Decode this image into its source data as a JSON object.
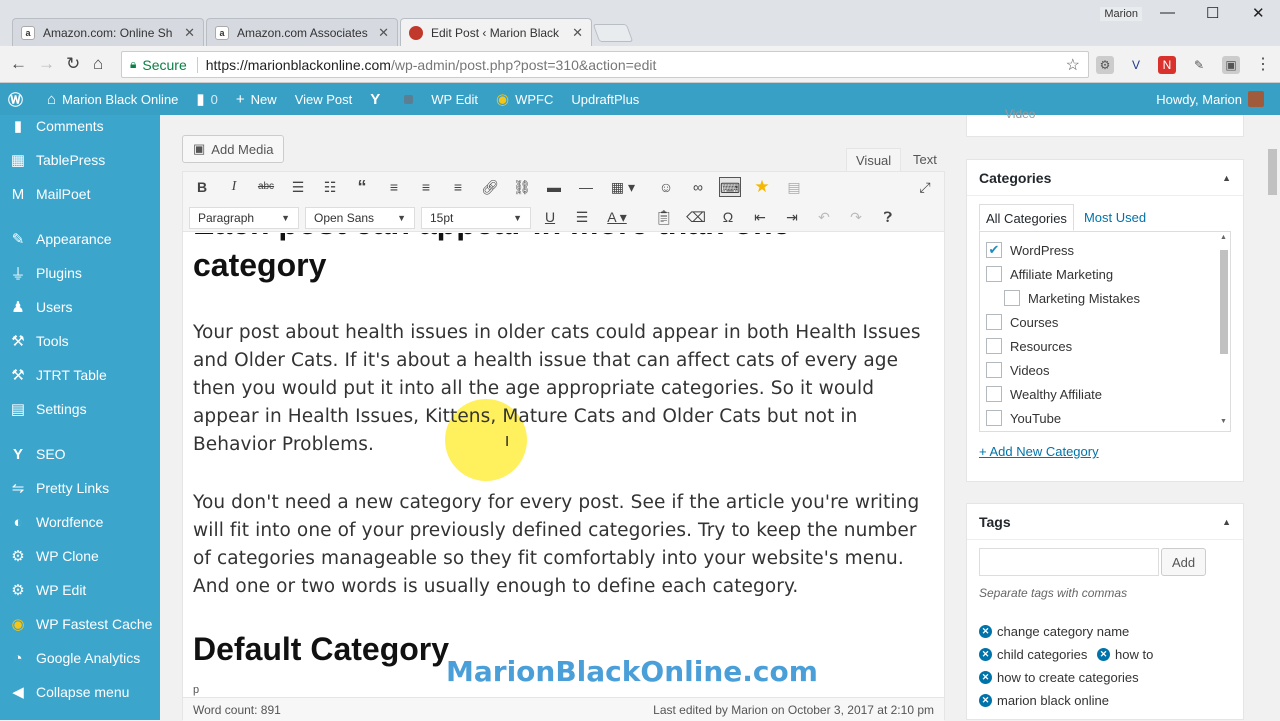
{
  "browser": {
    "tabs": [
      {
        "title": "Amazon.com: Online Sh",
        "icon": "amazon-icon"
      },
      {
        "title": "Amazon.com Associates",
        "icon": "amazon-icon"
      },
      {
        "title": "Edit Post ‹ Marion Black",
        "icon": "site-favicon"
      }
    ],
    "user": "Marion",
    "secure_label": "Secure",
    "url_host": "https://marionblackonline.com",
    "url_path": "/wp-admin/post.php?post=310&action=edit"
  },
  "adminbar": {
    "site_name": "Marion Black Online",
    "comments_count": "0",
    "new_label": "New",
    "view_post": "View Post",
    "wp_edit": "WP Edit",
    "wpfc": "WPFC",
    "updraft": "UpdraftPlus",
    "howdy": "Howdy, Marion"
  },
  "sidebar": {
    "items": [
      {
        "label": "Comments",
        "icon": "comments-icon"
      },
      {
        "label": "TablePress",
        "icon": "table-icon"
      },
      {
        "label": "MailPoet",
        "icon": "mailpoet-icon"
      },
      {
        "label": "Appearance",
        "icon": "brush-icon"
      },
      {
        "label": "Plugins",
        "icon": "plugin-icon"
      },
      {
        "label": "Users",
        "icon": "users-icon"
      },
      {
        "label": "Tools",
        "icon": "wrench-icon"
      },
      {
        "label": "JTRT Table",
        "icon": "jtrt-icon"
      },
      {
        "label": "Settings",
        "icon": "settings-icon"
      },
      {
        "label": "SEO",
        "icon": "yoast-icon"
      },
      {
        "label": "Pretty Links",
        "icon": "link-icon"
      },
      {
        "label": "Wordfence",
        "icon": "wordfence-icon"
      },
      {
        "label": "WP Clone",
        "icon": "gear-icon"
      },
      {
        "label": "WP Edit",
        "icon": "gear-icon"
      },
      {
        "label": "WP Fastest Cache",
        "icon": "cheetah-icon"
      },
      {
        "label": "Google Analytics",
        "icon": "analytics-icon"
      },
      {
        "label": "Collapse menu",
        "icon": "collapse-icon"
      }
    ]
  },
  "editor": {
    "add_media": "Add Media",
    "visual_tab": "Visual",
    "text_tab": "Text",
    "format_select": "Paragraph",
    "font_select": "Open Sans",
    "size_select": "15pt",
    "heading_partial": "Each post can appear in more than one",
    "heading_cont": "category",
    "para1": "Your post about health issues in older cats could appear in both Health Issues and Older Cats. If it's about a health issue that can affect cats of every age then you would put it into all the age appropriate categories. So it would appear in Health Issues, Kittens, Mature Cats and Older Cats but not in Behavior Problems.",
    "para2": "You don't need a new category for every post. See if the article you're writing will fit into one of your previously defined categories. Try to keep the number of categories manageable so they fit comfortably into your website's menu. And one or two words is usually enough to define each category.",
    "heading2": "Default Category",
    "path": "p",
    "word_count": "Word count: 891",
    "last_edited": "Last edited by Marion on October 3, 2017 at 2:10 pm",
    "watermark": "MarionBlackOnline.com"
  },
  "categories": {
    "title": "Categories",
    "tab_all": "All Categories",
    "tab_used": "Most Used",
    "items": [
      {
        "label": "WordPress",
        "checked": true,
        "child": false
      },
      {
        "label": "Affiliate Marketing",
        "checked": false,
        "child": false
      },
      {
        "label": "Marketing Mistakes",
        "checked": false,
        "child": true
      },
      {
        "label": "Courses",
        "checked": false,
        "child": false
      },
      {
        "label": "Resources",
        "checked": false,
        "child": false
      },
      {
        "label": "Videos",
        "checked": false,
        "child": false
      },
      {
        "label": "Wealthy Affiliate",
        "checked": false,
        "child": false
      },
      {
        "label": "YouTube",
        "checked": false,
        "child": false
      }
    ],
    "add_new": "+ Add New Category",
    "above_label": "Video"
  },
  "tags": {
    "title": "Tags",
    "add_button": "Add",
    "hint": "Separate tags with commas",
    "items": [
      "change category name",
      "child categories",
      "how to",
      "how to create categories",
      "marion black online"
    ]
  },
  "colors": {
    "admin_bar": "#39a0c5",
    "sidebar": "#3ca5cc",
    "link": "#0073aa",
    "highlight": "#ffeb28"
  }
}
